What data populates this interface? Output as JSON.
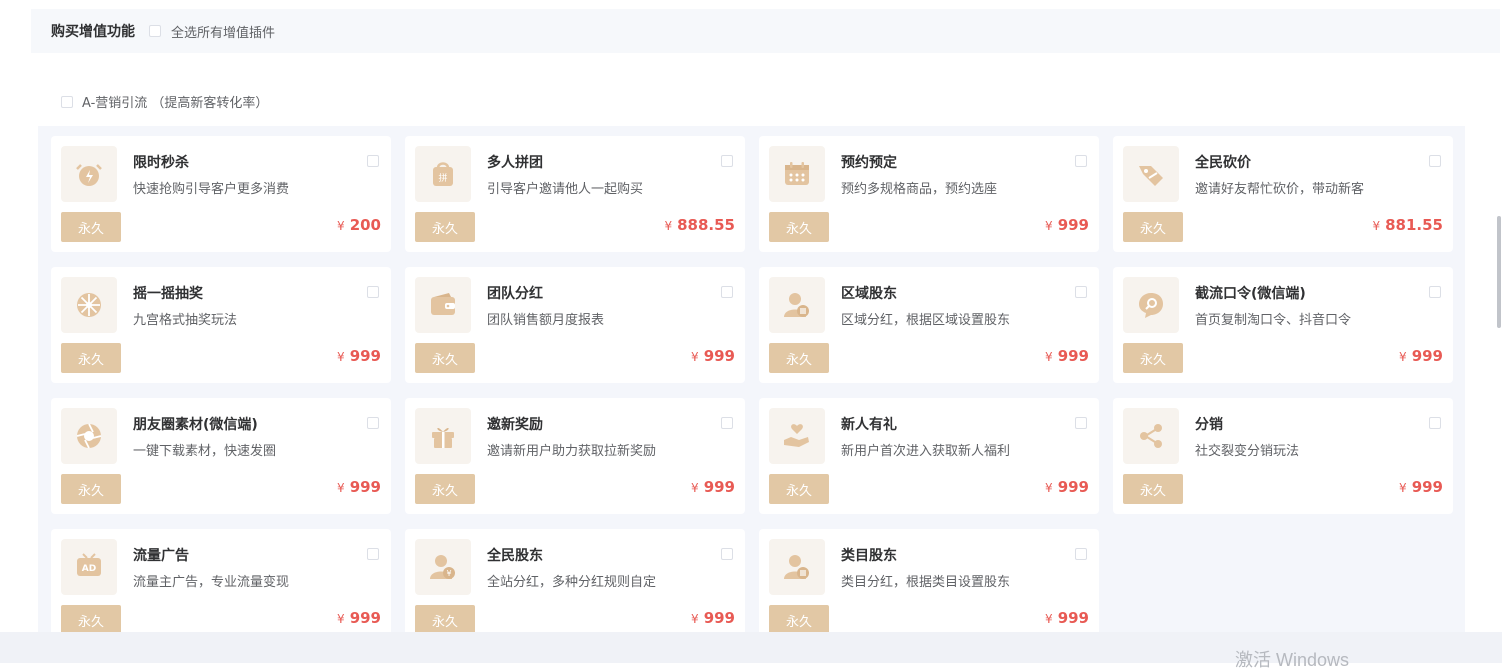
{
  "header": {
    "title": "购买增值功能",
    "select_all_label": "全选所有增值插件"
  },
  "category": {
    "label": "A-营销引流 （提高新客转化率）"
  },
  "currency_symbol": "¥",
  "plugins": [
    {
      "icon": "alarm-clock-icon",
      "name": "限时秒杀",
      "desc": "快速抢购引导客户更多消费",
      "badge": "永久",
      "price": "200"
    },
    {
      "icon": "shopping-bag-icon",
      "name": "多人拼团",
      "desc": "引导客户邀请他人一起购买",
      "badge": "永久",
      "price": "888.55"
    },
    {
      "icon": "calendar-icon",
      "name": "预约预定",
      "desc": "预约多规格商品，预约选座",
      "badge": "永久",
      "price": "999"
    },
    {
      "icon": "price-tag-icon",
      "name": "全民砍价",
      "desc": "邀请好友帮忙砍价，带动新客",
      "badge": "永久",
      "price": "881.55"
    },
    {
      "icon": "lottery-wheel-icon",
      "name": "摇一摇抽奖",
      "desc": "九宫格式抽奖玩法",
      "badge": "永久",
      "price": "999"
    },
    {
      "icon": "wallet-icon",
      "name": "团队分红",
      "desc": "团队销售额月度报表",
      "badge": "永久",
      "price": "999"
    },
    {
      "icon": "shareholder-icon",
      "name": "区域股东",
      "desc": "区域分红，根据区域设置股东",
      "badge": "永久",
      "price": "999"
    },
    {
      "icon": "chat-search-icon",
      "name": "截流口令(微信端)",
      "desc": "首页复制淘口令、抖音口令",
      "badge": "永久",
      "price": "999"
    },
    {
      "icon": "camera-aperture-icon",
      "name": "朋友圈素材(微信端)",
      "desc": "一键下载素材，快速发圈",
      "badge": "永久",
      "price": "999"
    },
    {
      "icon": "gift-icon",
      "name": "邀新奖励",
      "desc": "邀请新用户助力获取拉新奖励",
      "badge": "永久",
      "price": "999"
    },
    {
      "icon": "hand-heart-icon",
      "name": "新人有礼",
      "desc": "新用户首次进入获取新人福利",
      "badge": "永久",
      "price": "999"
    },
    {
      "icon": "share-icon",
      "name": "分销",
      "desc": "社交裂变分销玩法",
      "badge": "永久",
      "price": "999"
    },
    {
      "icon": "ad-tv-icon",
      "name": "流量广告",
      "desc": "流量主广告，专业流量变现",
      "badge": "永久",
      "price": "999"
    },
    {
      "icon": "user-yen-icon",
      "name": "全民股东",
      "desc": "全站分红，多种分红规则自定",
      "badge": "永久",
      "price": "999"
    },
    {
      "icon": "user-list-icon",
      "name": "类目股东",
      "desc": "类目分红，根据类目设置股东",
      "badge": "永久",
      "price": "999"
    }
  ],
  "watermark": "激活 Windows",
  "colors": {
    "accent": "#e2c8a5",
    "icon_color": "#e3c4a0",
    "price": "#e85a54",
    "panel_bg": "#f4f6fb",
    "header_bg": "#f6f8fb"
  }
}
